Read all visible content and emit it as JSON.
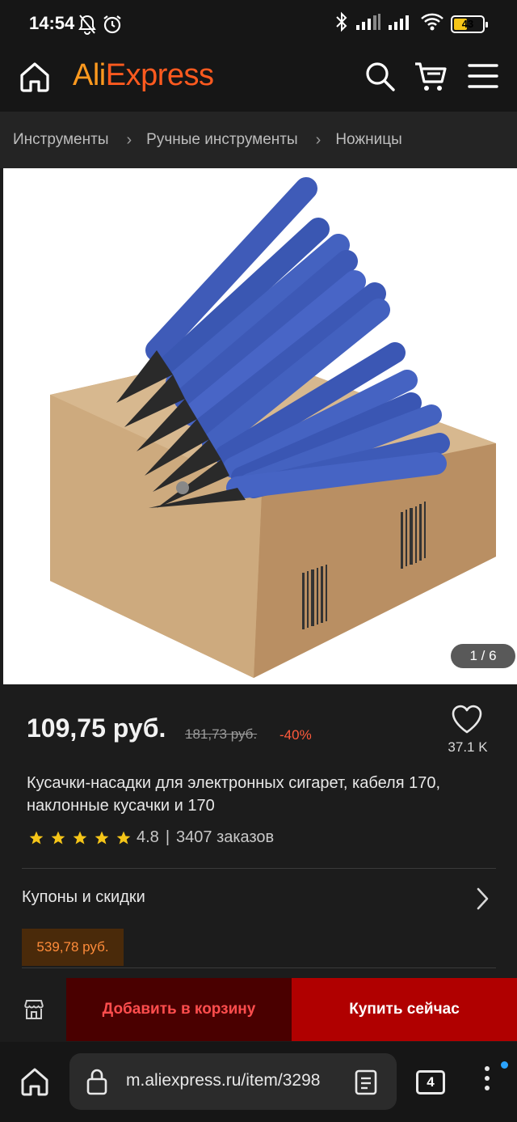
{
  "status_bar": {
    "time": "14:54",
    "battery_level": "43",
    "icons": [
      "mute-bell-icon",
      "alarm-icon",
      "bluetooth-icon",
      "signal-icon",
      "signal-icon",
      "wifi-icon",
      "battery-icon"
    ]
  },
  "header": {
    "logo_part1": "Ali",
    "logo_part2": "Express",
    "icons": [
      "home-icon",
      "search-icon",
      "cart-icon",
      "menu-icon"
    ]
  },
  "breadcrumb": {
    "items": [
      "Инструменты",
      "Ручные инструменты",
      "Ножницы"
    ]
  },
  "gallery": {
    "counter": "1 / 6",
    "current": 1,
    "total": 6
  },
  "product": {
    "price": "109,75 руб.",
    "old_price": "181,73 руб.",
    "discount": "-40%",
    "wishlist_count": "37.1 K",
    "title": "Кусачки-насадки для электронных сигарет, кабеля 170, наклонные кусачки и 170",
    "rating": "4.8",
    "rating_stars": 5,
    "separator": "|",
    "orders": "3407 заказов"
  },
  "coupons": {
    "label": "Купоны и скидки",
    "badge": "539,78 руб."
  },
  "actions": {
    "add_to_cart": "Добавить в корзину",
    "buy_now": "Купить сейчас"
  },
  "browser": {
    "url": "m.aliexpress.ru/item/3298",
    "tab_count": "4"
  },
  "colors": {
    "brand_orange": "#ff5a1f",
    "star": "#f5c518",
    "discount": "#ff5a3c",
    "buy_now": "#b00000",
    "add_to_cart_bg": "#4a0000",
    "accent_blue": "#2aa3ff"
  }
}
